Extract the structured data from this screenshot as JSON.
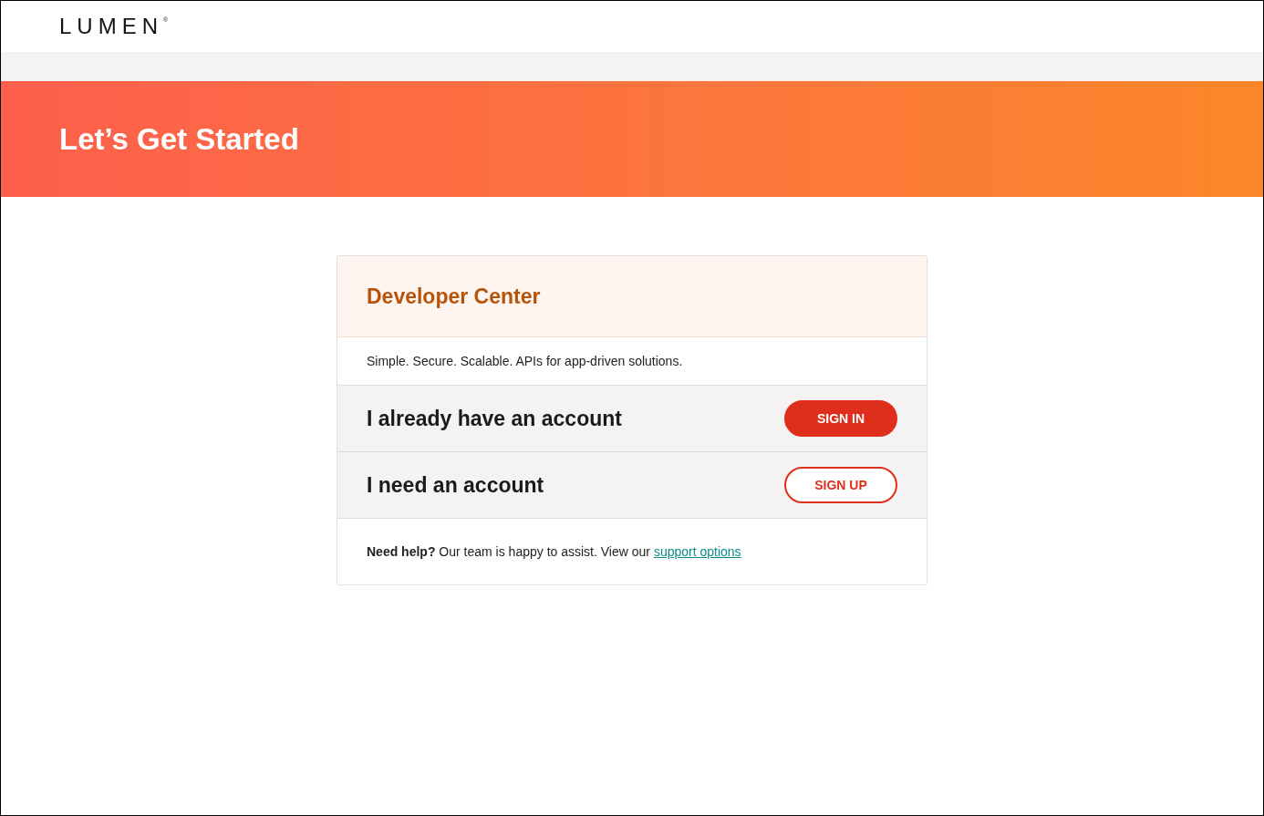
{
  "header": {
    "logo": "LUMEN",
    "logo_mark": "®"
  },
  "banner": {
    "title": "Let’s Get Started"
  },
  "card": {
    "title": "Developer Center",
    "tagline": "Simple. Secure. Scalable. APIs for app-driven solutions.",
    "rows": [
      {
        "label": "I already have an account",
        "button": {
          "label": "SIGN IN",
          "kind": "primary"
        }
      },
      {
        "label": "I need an account",
        "button": {
          "label": "SIGN UP",
          "kind": "outline"
        }
      }
    ],
    "help": {
      "text": "**Need help?** Our team is happy to assist. View our ",
      "link": "support options"
    }
  }
}
